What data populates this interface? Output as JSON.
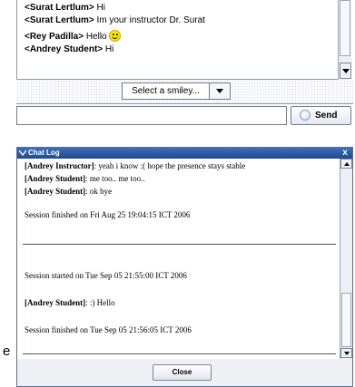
{
  "chat": {
    "messages": [
      {
        "sender": "<Surat Lertlum>",
        "text": " Hi"
      },
      {
        "sender": "<Surat Lertlum>",
        "text": " Im your instructor Dr. Surat"
      },
      {
        "sender": "<Rey Padilla>",
        "text": " Hello",
        "emoticon": "smiley-icon"
      },
      {
        "sender": "<Andrey Student>",
        "text": " Hi"
      }
    ],
    "smiley_select": "Select a smiley...",
    "send_label": "Send",
    "input_value": ""
  },
  "log": {
    "title": "Chat Log",
    "close_x": "x",
    "lines": [
      {
        "sender": "[Andrey Instructor]",
        "text": ": yeah i know :( hope the presence stays stable"
      },
      {
        "sender": "[Andrey Student]",
        "text": ": me too.. me too.."
      },
      {
        "sender": "[Andrey Student]",
        "text": ": ok bye"
      },
      {
        "sender": "",
        "text": "Session finished on Fri Aug 25 19:04:15 ICT 2006"
      },
      {
        "sender": "",
        "text": "Session started on Tue Sep 05 21:55:00 ICT 2006"
      },
      {
        "sender": "[Andrey Student]",
        "text": ": :) Hello"
      },
      {
        "sender": "",
        "text": "Session finished on Tue Sep 05 21:56:05 ICT 2006"
      }
    ],
    "close_label": "Close"
  },
  "stray_text": "e",
  "colors": {
    "titlebar": "#2a5aa3",
    "border": "#6f7d93",
    "smiley": "#ffe600"
  }
}
